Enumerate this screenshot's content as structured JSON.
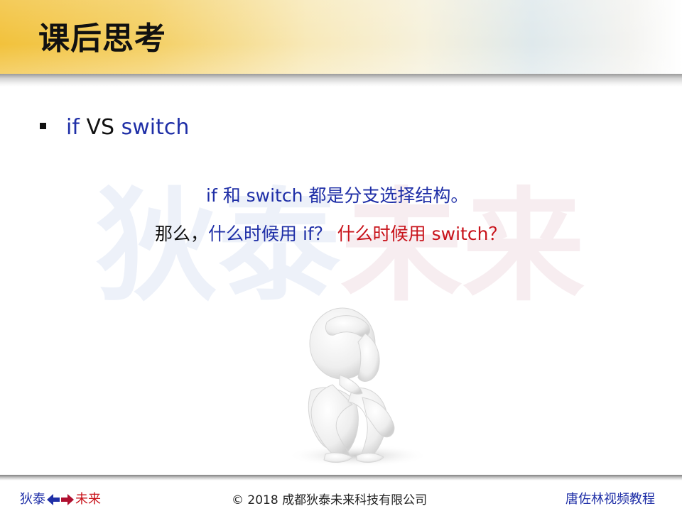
{
  "slide": {
    "title": "课后思考",
    "bullet": {
      "part1": "if",
      "part2": "VS",
      "part3": "switch"
    },
    "watermark": {
      "blue": "狄泰",
      "red": "未来"
    },
    "line1": "if 和 switch 都是分支选择结构。",
    "line2": {
      "lead": "那么，",
      "q1": "什么时候用 if？",
      "q2": "什么时候用 switch？"
    },
    "figure": {
      "icon": "thinking-person-icon"
    }
  },
  "footer": {
    "left_a": "狄泰",
    "left_b": "未来",
    "arrow_icon": "bidirectional-arrow-icon",
    "center": "© 2018 成都狄泰未来科技有限公司",
    "right": "唐佐林视频教程"
  },
  "colors": {
    "blue": "#1f2fa7",
    "red": "#c8121a",
    "header_gold": "#f2c23c"
  }
}
